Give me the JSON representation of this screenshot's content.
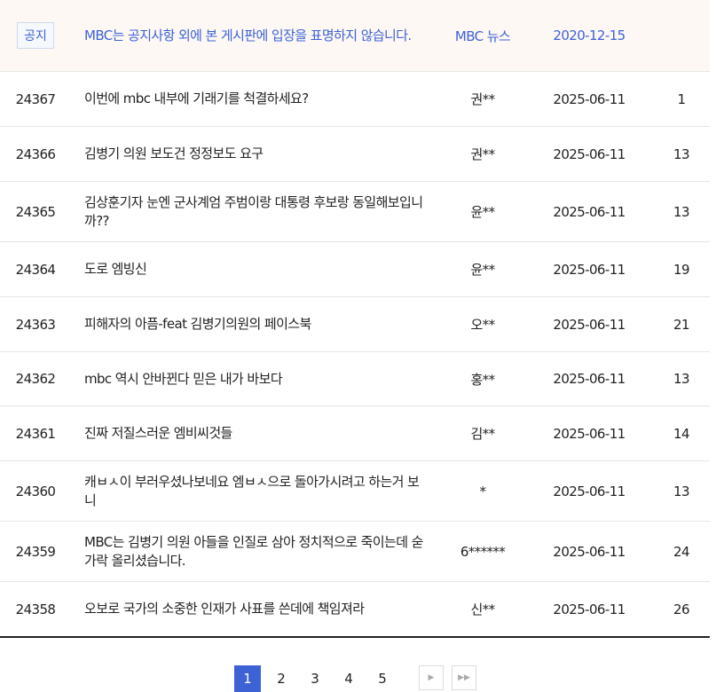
{
  "notice": {
    "badge": "공지",
    "title": "MBC는 공지사항 외에 본 게시판에 입장을 표명하지 않습니다.",
    "author": "MBC 뉴스",
    "date": "2020-12-15"
  },
  "posts": [
    {
      "num": "24367",
      "title": "이번에 mbc 내부에 기래기를 척결하세요?",
      "author": "권**",
      "date": "2025-06-11",
      "views": "1"
    },
    {
      "num": "24366",
      "title": "김병기 의원 보도건 정정보도 요구",
      "author": "권**",
      "date": "2025-06-11",
      "views": "13"
    },
    {
      "num": "24365",
      "title": "김상훈기자 눈엔 군사계엄 주범이랑 대통령 후보랑 동일해보입니까??",
      "author": "윤**",
      "date": "2025-06-11",
      "views": "13"
    },
    {
      "num": "24364",
      "title": "도로 엠빙신",
      "author": "윤**",
      "date": "2025-06-11",
      "views": "19"
    },
    {
      "num": "24363",
      "title": "피해자의 아픔-feat 김병기의원의 페이스북",
      "author": "오**",
      "date": "2025-06-11",
      "views": "21"
    },
    {
      "num": "24362",
      "title": "mbc 역시 안바뀐다 믿은 내가 바보다",
      "author": "홍**",
      "date": "2025-06-11",
      "views": "13"
    },
    {
      "num": "24361",
      "title": "진짜 저질스러운 엠비씨것들",
      "author": "김**",
      "date": "2025-06-11",
      "views": "14"
    },
    {
      "num": "24360",
      "title": "캐ㅂㅅ이 부러우셨나보네요 엠ㅂㅅ으로 돌아가시려고 하는거 보니",
      "author": "*",
      "date": "2025-06-11",
      "views": "13"
    },
    {
      "num": "24359",
      "title": "MBC는 김병기 의원 아들을 인질로 삼아 정치적으로 죽이는데 숟가락 올리셨습니다.",
      "author": "6******",
      "date": "2025-06-11",
      "views": "24"
    },
    {
      "num": "24358",
      "title": "오보로 국가의 소중한 인재가 사표를 쓴데에 책임져라",
      "author": "신**",
      "date": "2025-06-11",
      "views": "26"
    }
  ],
  "pagination": {
    "pages": [
      "1",
      "2",
      "3",
      "4",
      "5"
    ],
    "current": "1",
    "next_icon": "next-page-icon",
    "last_icon": "last-page-icon"
  }
}
